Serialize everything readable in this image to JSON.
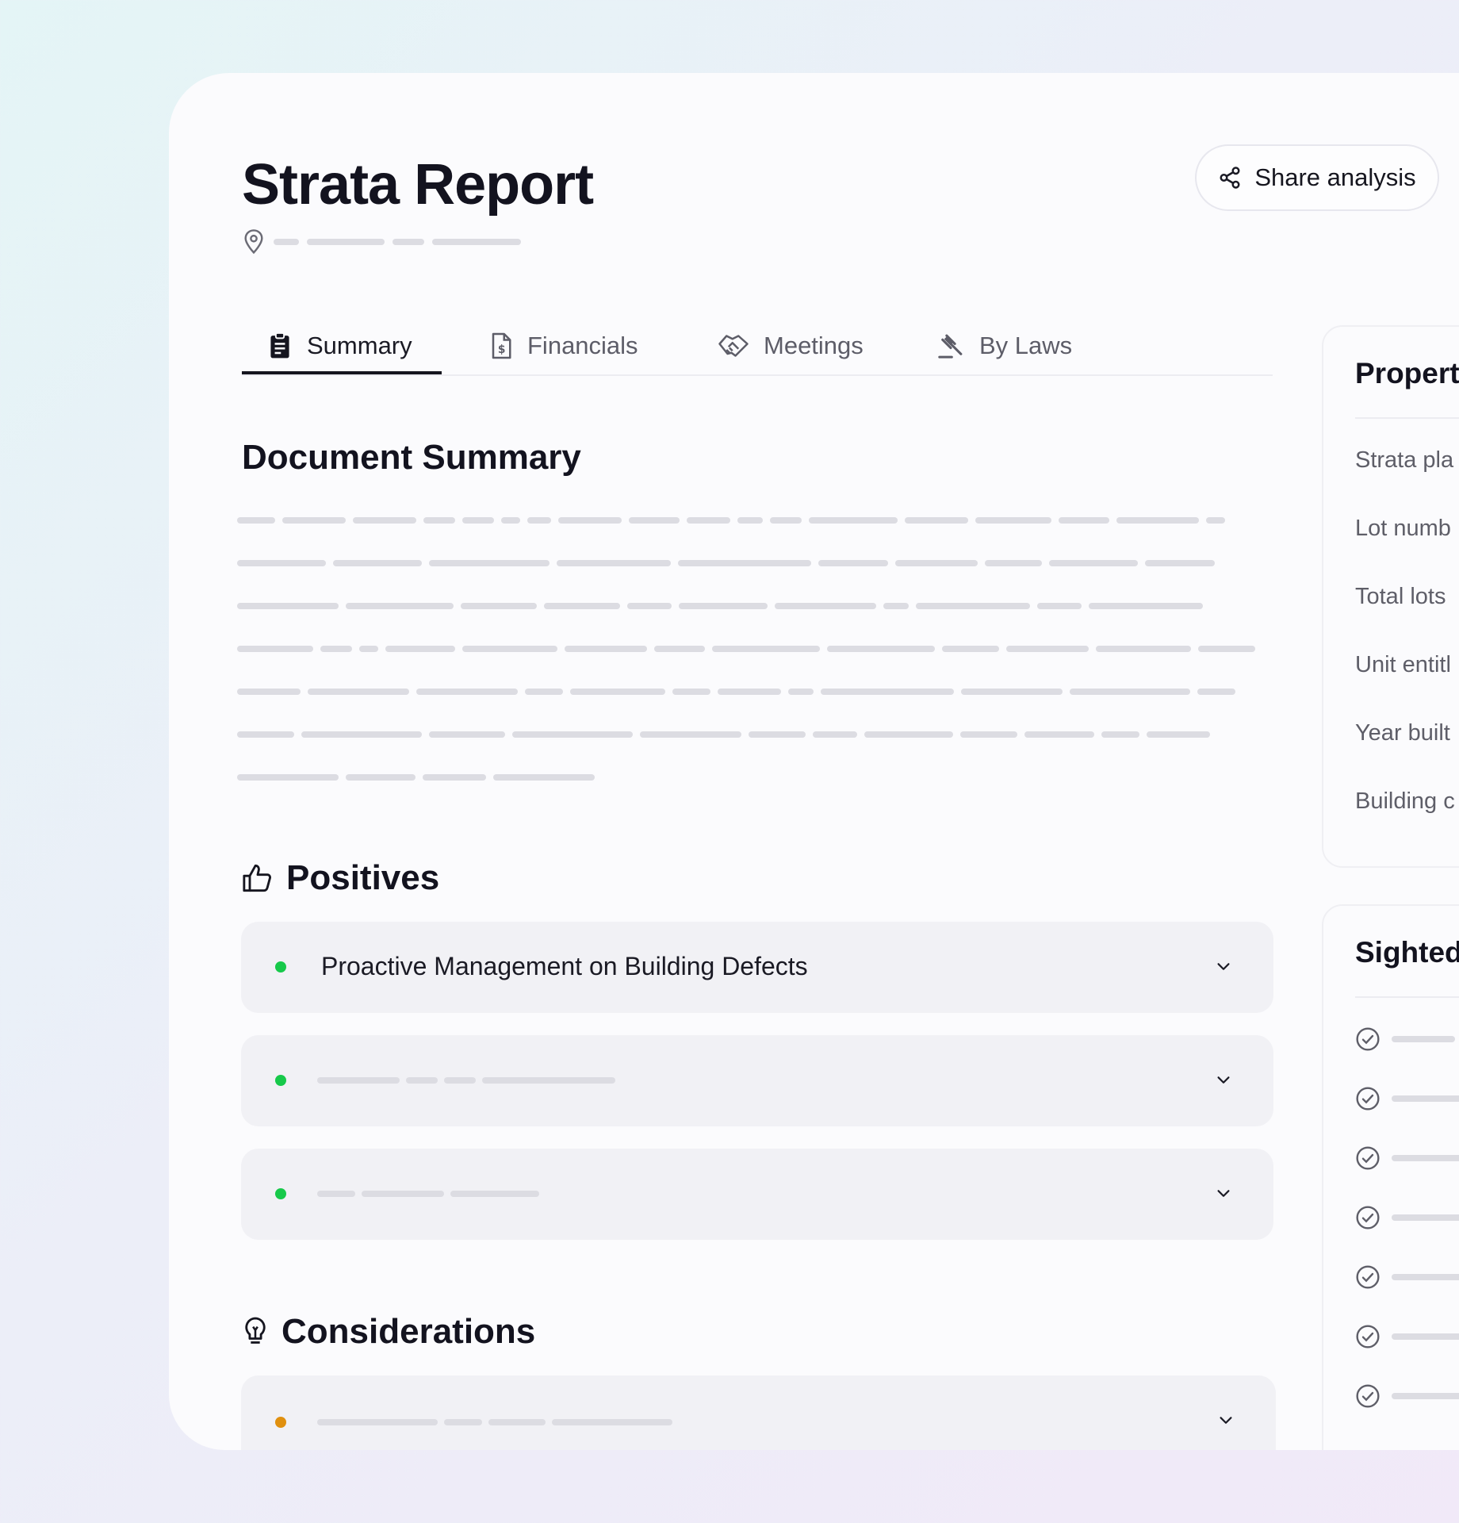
{
  "report": {
    "title": "Strata Report"
  },
  "share": {
    "label": "Share analysis",
    "icon": "share-icon"
  },
  "tabs": [
    {
      "label": "Summary",
      "icon": "clipboard-icon",
      "active": true
    },
    {
      "label": "Financials",
      "icon": "document-dollar-icon",
      "active": false
    },
    {
      "label": "Meetings",
      "icon": "handshake-icon",
      "active": false
    },
    {
      "label": "By Laws",
      "icon": "gavel-icon",
      "active": false
    }
  ],
  "document_summary": {
    "title": "Document Summary"
  },
  "positives": {
    "title": "Positives",
    "items": [
      {
        "label": "Proactive Management on Building Defects",
        "color": "#17c94a"
      },
      {
        "label": "",
        "color": "#17c94a"
      },
      {
        "label": "",
        "color": "#17c94a"
      }
    ]
  },
  "considerations": {
    "title": "Considerations",
    "items": [
      {
        "label": "",
        "color": "#e0900f"
      }
    ]
  },
  "property": {
    "title": "Propert",
    "rows": [
      "Strata pla",
      "Lot numb",
      "Total lots",
      "Unit entitl",
      "Year built",
      "Building c"
    ]
  },
  "sighted": {
    "title": "Sighted"
  },
  "colors": {
    "positive": "#17c94a",
    "consideration": "#e0900f",
    "text": "#13131f"
  }
}
